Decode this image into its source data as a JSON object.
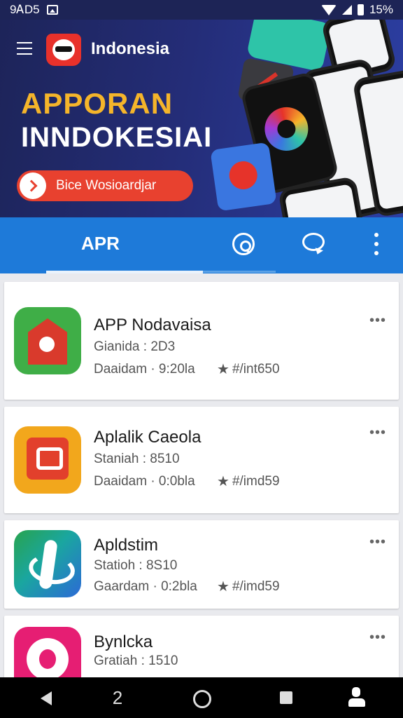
{
  "status_bar": {
    "time": "9ᎪD5",
    "battery_text": "15%"
  },
  "banner": {
    "brand_name": "Indonesia",
    "headline_line1": "APPORAN",
    "headline_line2": "INNDOKESIAI",
    "cta_label": "Bice Wosioardjar"
  },
  "tabs": {
    "active_label": "APR"
  },
  "apps": [
    {
      "name": "APP Nodavaisa",
      "line1": "Gianida : 2D3",
      "line2": "Daaidam · 9:20la",
      "rating": "#/int650",
      "icon": "app-icon-red-house",
      "icon_color": "#3fae47"
    },
    {
      "name": "Aplalik Caeola",
      "line1": "Staniah : 8510",
      "line2": "Daaidam · 0:0bla",
      "rating": "#/imd59",
      "icon": "app-icon-chat-square",
      "icon_color": "#f2a71c"
    },
    {
      "name": "Apldstim",
      "line1": "Statioh : 8S10",
      "line2": "Gaardam · 0:2bla",
      "rating": "#/imd59",
      "icon": "app-icon-leaf",
      "icon_color": "#2c6ad6"
    },
    {
      "name": "Bynlcka",
      "line1": "Gratiah : 1510",
      "line2": "",
      "rating": "",
      "icon": "app-icon-pink-gear",
      "icon_color": "#e61e73"
    }
  ],
  "colors": {
    "banner_bg": "#242d78",
    "tab_bar": "#1e7ad9",
    "accent_yellow": "#f5b52a",
    "cta_red": "#e8412f"
  }
}
